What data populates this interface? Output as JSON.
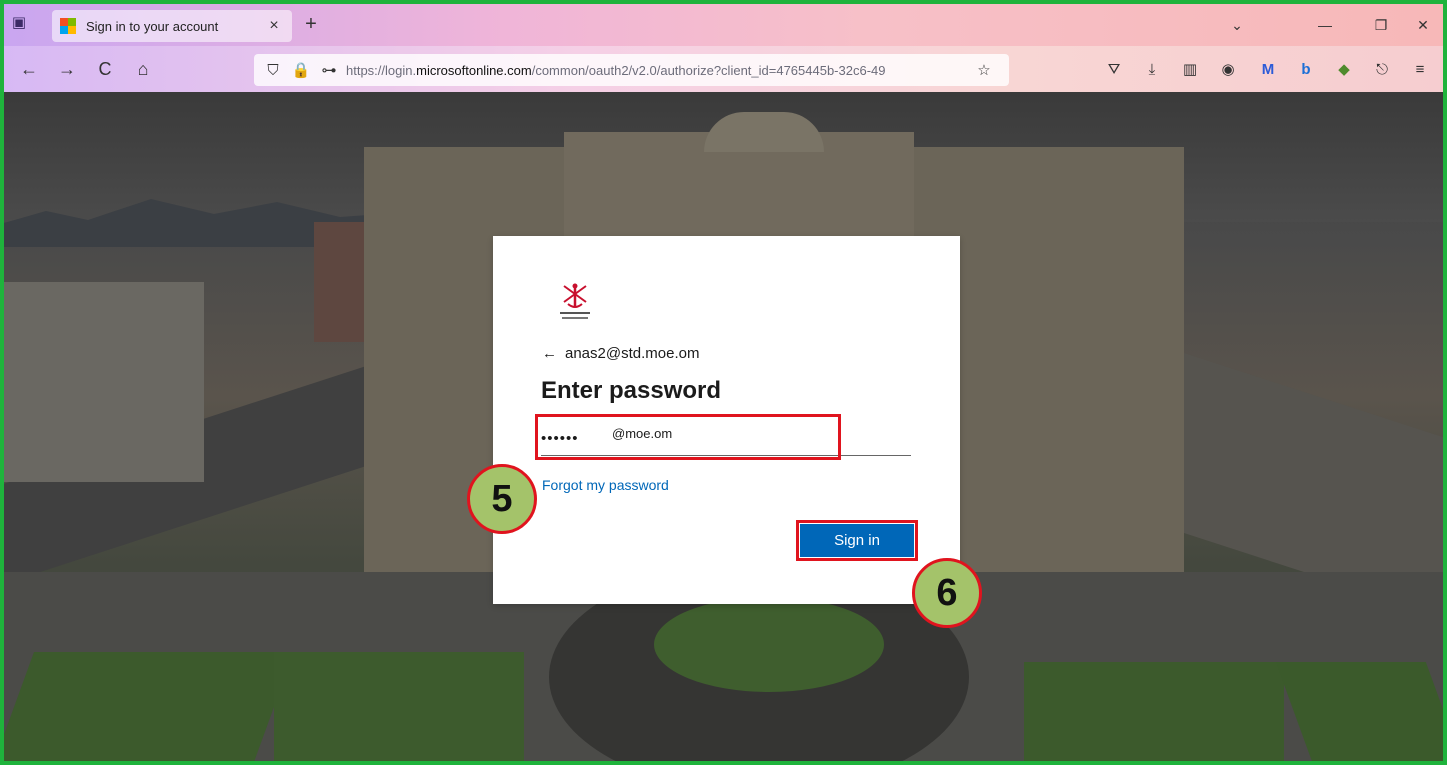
{
  "browser": {
    "tab_title": "Sign in to your account",
    "tab_close": "×",
    "new_tab": "+",
    "url_prefix": "https://login.",
    "url_host": "microsoftonline.com",
    "url_path": "/common/oauth2/v2.0/authorize?client_id=4765445b-32c6-49",
    "icons": {
      "tab_list": "▣",
      "back": "←",
      "forward": "→",
      "reload": "C",
      "home": "⌂",
      "shield": "⛉",
      "lock": "🔒",
      "key": "⊶",
      "bookmark": "☆",
      "pocket": "⛛",
      "download": "⤓",
      "reader": "▥",
      "account": "◉",
      "extension_m": "M",
      "extension_b": "b",
      "extension_gem": "◆",
      "share": "⎋",
      "menu": "≡",
      "chevron": "⌄",
      "minimize": "—",
      "restore": "❐",
      "close": "✕"
    }
  },
  "login": {
    "account": "anas2@std.moe.om",
    "back_arrow": "←",
    "heading": "Enter password",
    "password_masked": "••••••",
    "password_overlay": "@moe.om",
    "forgot_link": "Forgot my password",
    "sign_in_label": "Sign in"
  },
  "annotations": {
    "step5": "5",
    "step6": "6",
    "accent_color": "#e0141e",
    "badge_color": "#a4c36a"
  }
}
